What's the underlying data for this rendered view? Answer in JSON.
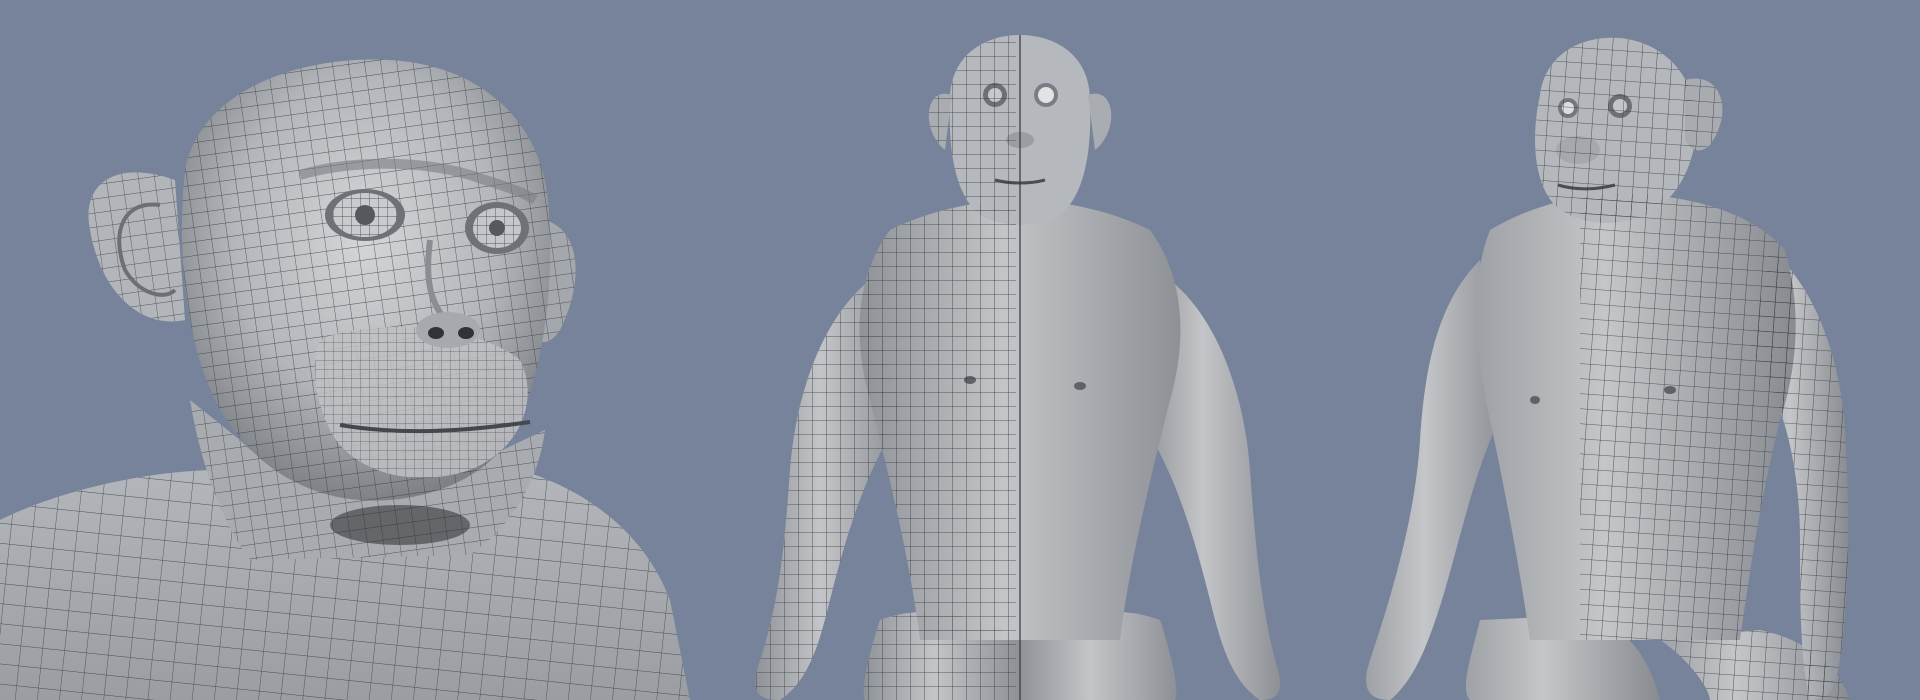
{
  "scene": {
    "background_color": "#77839a",
    "mesh_color": "#b9bcc0",
    "wire_color": "#3a3d42",
    "views": [
      {
        "id": "bust",
        "description_name": "head-closeup-view"
      },
      {
        "id": "front",
        "description_name": "front-full-view"
      },
      {
        "id": "threequarter",
        "description_name": "three-quarter-view"
      }
    ]
  }
}
